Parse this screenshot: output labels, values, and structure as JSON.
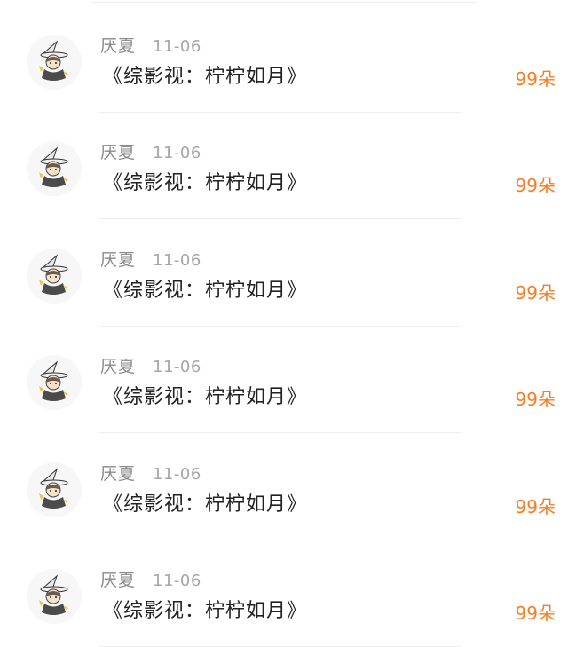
{
  "comments": [
    {
      "user": "厌夏",
      "date": "11-06",
      "text": "《综影视：柠柠如月》",
      "gift": "99朵"
    },
    {
      "user": "厌夏",
      "date": "11-06",
      "text": "《综影视：柠柠如月》",
      "gift": "99朵"
    },
    {
      "user": "厌夏",
      "date": "11-06",
      "text": "《综影视：柠柠如月》",
      "gift": "99朵"
    },
    {
      "user": "厌夏",
      "date": "11-06",
      "text": "《综影视：柠柠如月》",
      "gift": "99朵"
    },
    {
      "user": "厌夏",
      "date": "11-06",
      "text": "《综影视：柠柠如月》",
      "gift": "99朵"
    },
    {
      "user": "厌夏",
      "date": "11-06",
      "text": "《综影视：柠柠如月》",
      "gift": "99朵"
    }
  ],
  "colors": {
    "gift": "#f57e24",
    "username": "#8a8a8a",
    "date": "#a6a6a6",
    "title": "#222222"
  },
  "icons": {
    "avatar": "cartoon-character-with-witch-hat-avatar"
  }
}
